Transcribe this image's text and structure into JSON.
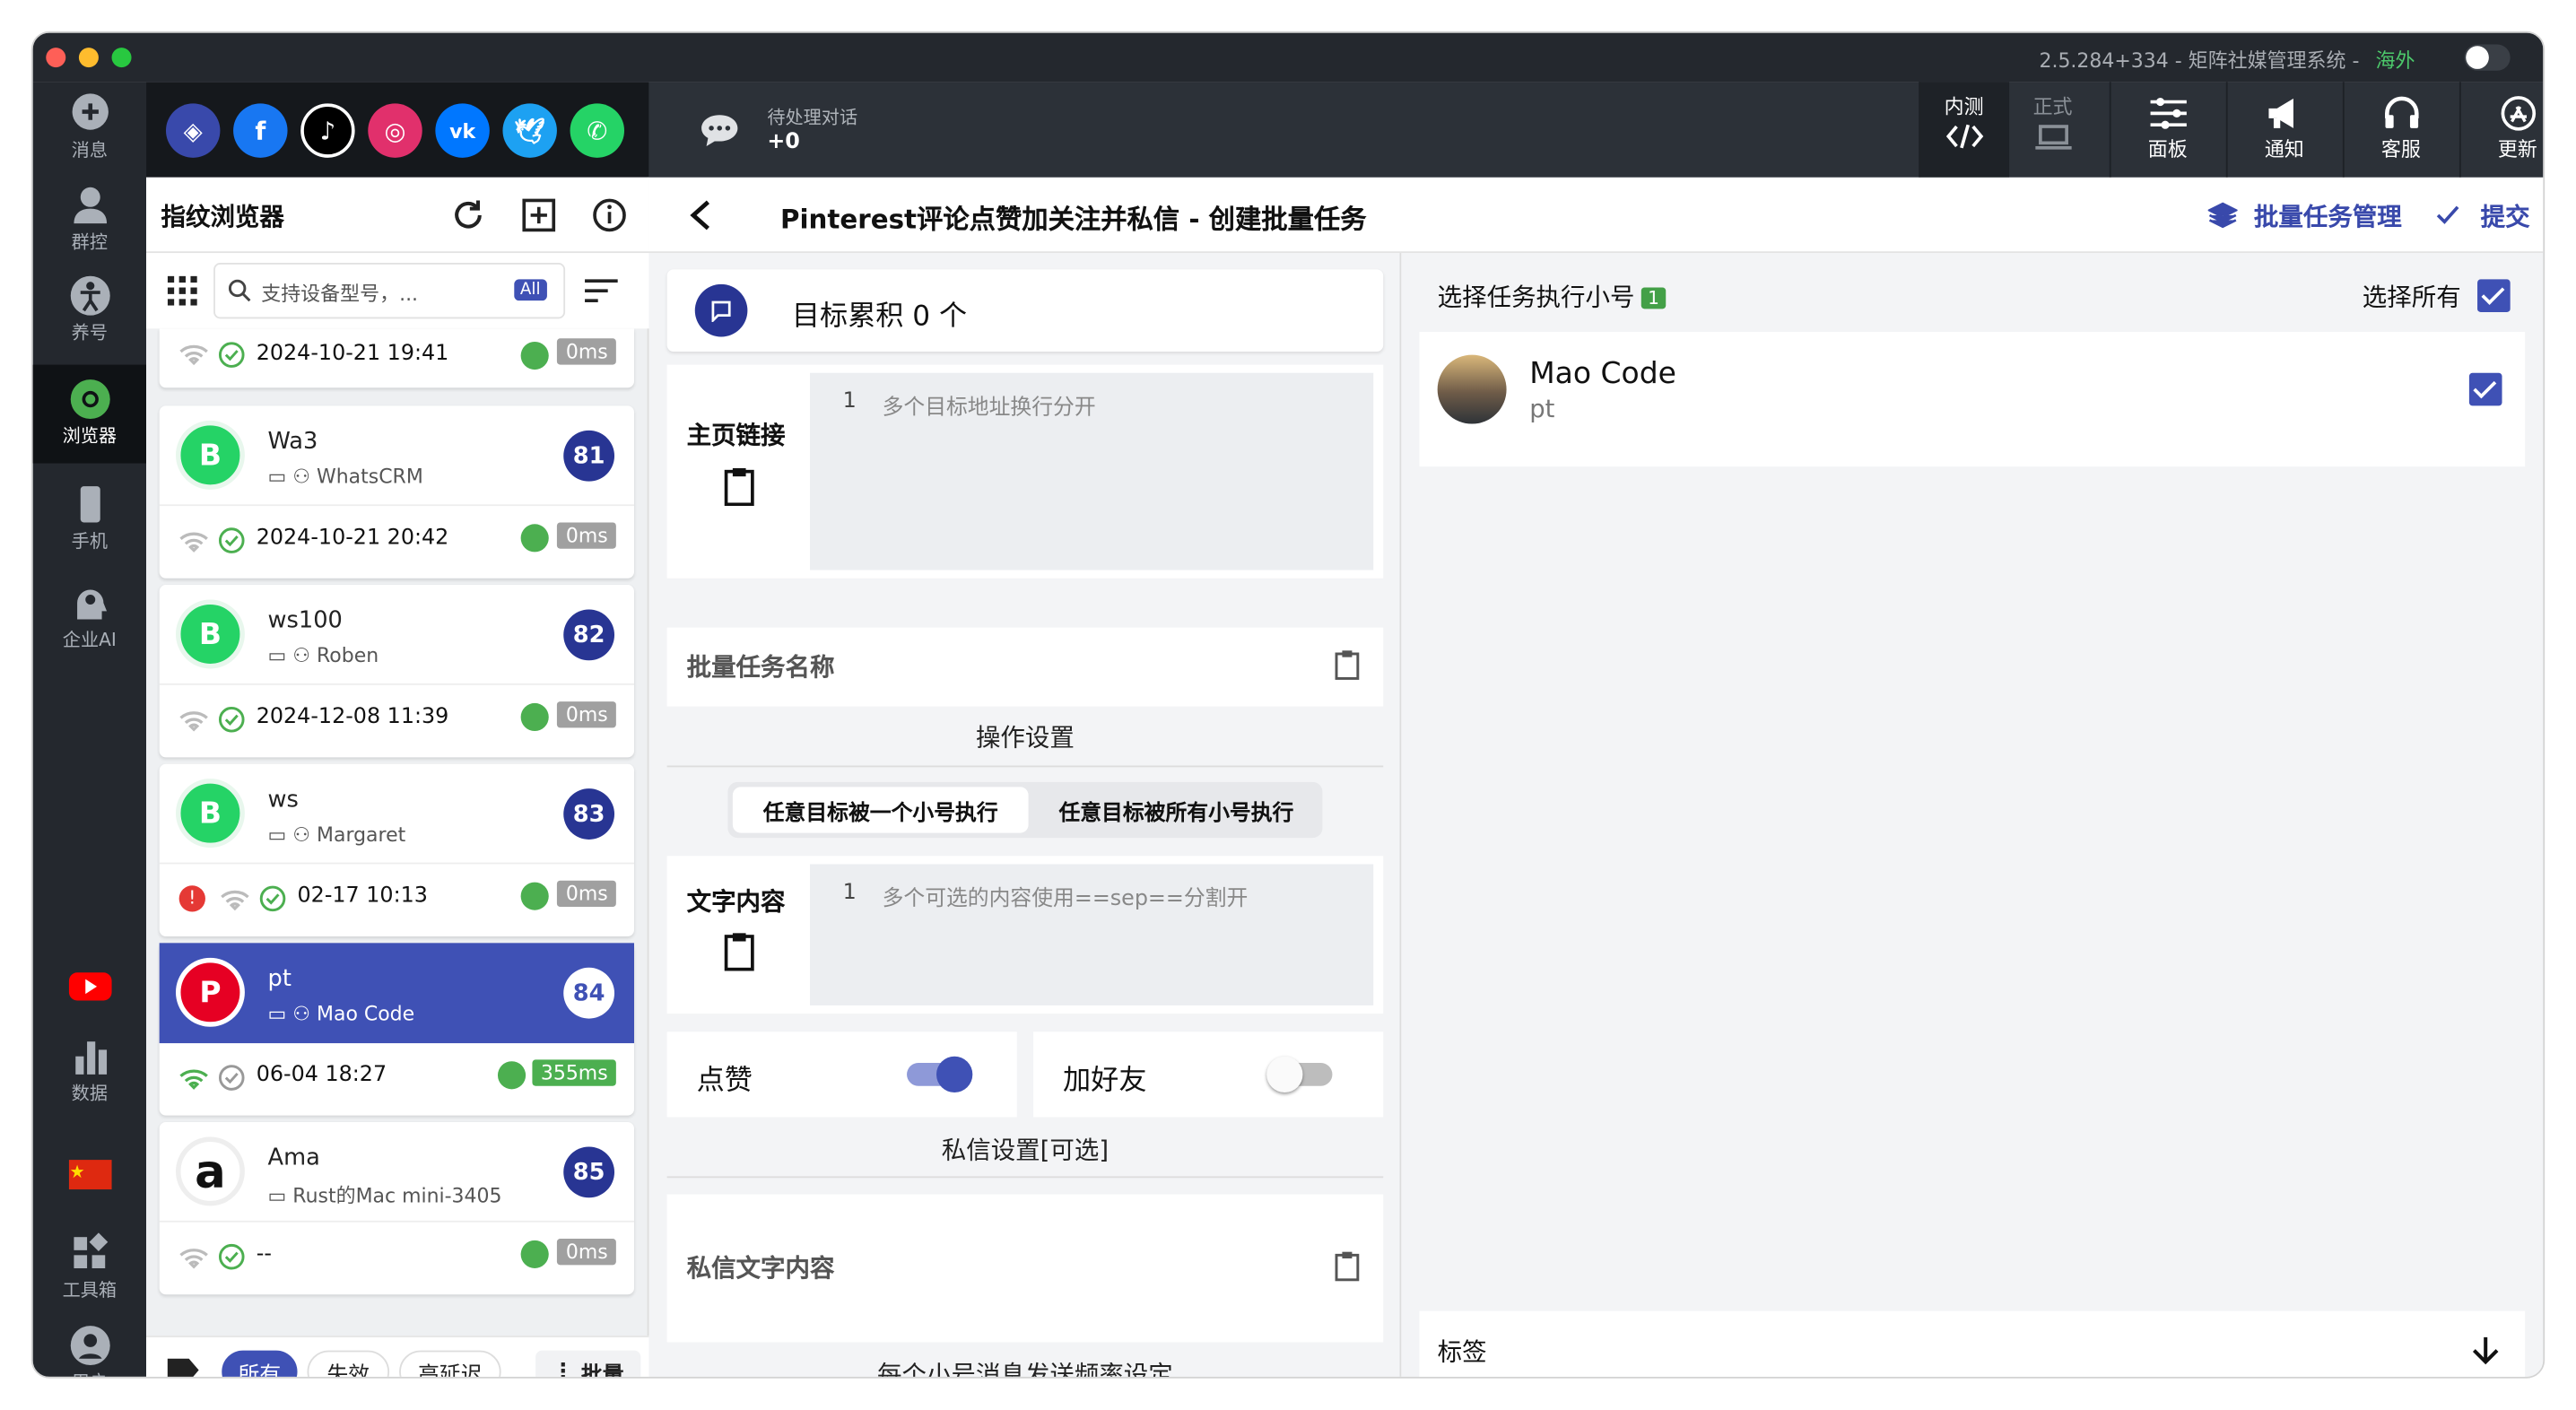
{
  "window": {
    "app_title": "2.5.284+334 - 矩阵社媒管理系统",
    "separator": "-",
    "region": "海外"
  },
  "left_nav": [
    {
      "label": "消息",
      "icon": "chat-bubble-icon"
    },
    {
      "label": "群控",
      "icon": "group-control-icon"
    },
    {
      "label": "养号",
      "icon": "accessibility-icon"
    },
    {
      "label": "浏览器",
      "icon": "chrome-icon"
    },
    {
      "label": "手机",
      "icon": "phone-icon"
    },
    {
      "label": "企业AI",
      "icon": "ai-head-icon"
    },
    {
      "label": "",
      "icon": "youtube-icon"
    },
    {
      "label": "数据",
      "icon": "bar-chart-icon"
    },
    {
      "label": "",
      "icon": "china-flag-icon"
    },
    {
      "label": "工具箱",
      "icon": "toolbox-icon"
    },
    {
      "label": "用户",
      "icon": "user-icon"
    }
  ],
  "social": [
    "browser",
    "facebook",
    "tiktok",
    "instagram",
    "vk",
    "twitter",
    "whatsapp"
  ],
  "topbar": {
    "pending_label": "待处理对话",
    "pending_value": "+0",
    "buttons": [
      {
        "label": "内测",
        "icon": "code-icon"
      },
      {
        "label": "正式",
        "icon": "laptop-icon"
      },
      {
        "label": "面板",
        "icon": "sliders-icon"
      },
      {
        "label": "通知",
        "icon": "megaphone-icon"
      },
      {
        "label": "客服",
        "icon": "headset-icon"
      },
      {
        "label": "更新",
        "icon": "app-store-icon"
      }
    ]
  },
  "browser_panel": {
    "title": "指纹浏览器",
    "search_placeholder": "支持设备型号，...",
    "search_tag": "All",
    "first_row": {
      "datetime": "2024-10-21 19:41",
      "latency": "0ms"
    },
    "cards": [
      {
        "name": "Wa3",
        "sub": "WhatsCRM",
        "num": "81",
        "datetime": "2024-10-21 20:42",
        "latency": "0ms",
        "avatar": "B",
        "avatar_color": "#25d366"
      },
      {
        "name": "ws100",
        "sub": "Roben",
        "num": "82",
        "datetime": "2024-12-08 11:39",
        "latency": "0ms",
        "avatar": "B",
        "avatar_color": "#25d366"
      },
      {
        "name": "ws",
        "sub": "Margaret",
        "num": "83",
        "datetime": "02-17 10:13",
        "latency": "0ms",
        "avatar": "B",
        "avatar_color": "#25d366"
      },
      {
        "name": "pt",
        "sub": "Mao Code",
        "num": "84",
        "datetime": "06-04 18:27",
        "latency": "355ms",
        "avatar": "P",
        "avatar_color": "#e60023"
      },
      {
        "name": "Ama",
        "sub": "Rust的Mac mini-3405",
        "num": "85",
        "datetime": "--",
        "latency": "0ms",
        "avatar": "a",
        "avatar_color": "#ffffff"
      }
    ],
    "filters": [
      "所有",
      "失效",
      "高延迟"
    ],
    "batch": "批量"
  },
  "header": {
    "title": "Pinterest评论点赞加关注并私信 - 创建批量任务",
    "manage": "批量任务管理",
    "submit": "提交"
  },
  "form": {
    "target_count": "目标累积 0 个",
    "homepage_label": "主页链接",
    "line_no": "1",
    "homepage_placeholder": "多个目标地址换行分开",
    "task_name_placeholder": "批量任务名称",
    "op_settings": "操作设置",
    "mode_a": "任意目标被一个小号执行",
    "mode_b": "任意目标被所有小号执行",
    "text_label": "文字内容",
    "text_placeholder": "多个可选的内容使用==sep==分割开",
    "like_label": "点赞",
    "add_friend_label": "加好友",
    "like_on": true,
    "add_friend_on": false,
    "dm_settings": "私信设置[可选]",
    "dm_placeholder": "私信文字内容",
    "freq_title": "每个小号消息发送频率设定"
  },
  "accounts": {
    "title": "选择任务执行小号",
    "count": "1",
    "select_all": "选择所有",
    "items": [
      {
        "name": "Mao Code",
        "sub": "pt"
      }
    ],
    "tag_label": "标签"
  },
  "colors": {
    "accent": "#3f51b5",
    "green": "#4caf50",
    "dark": "#24282e"
  }
}
